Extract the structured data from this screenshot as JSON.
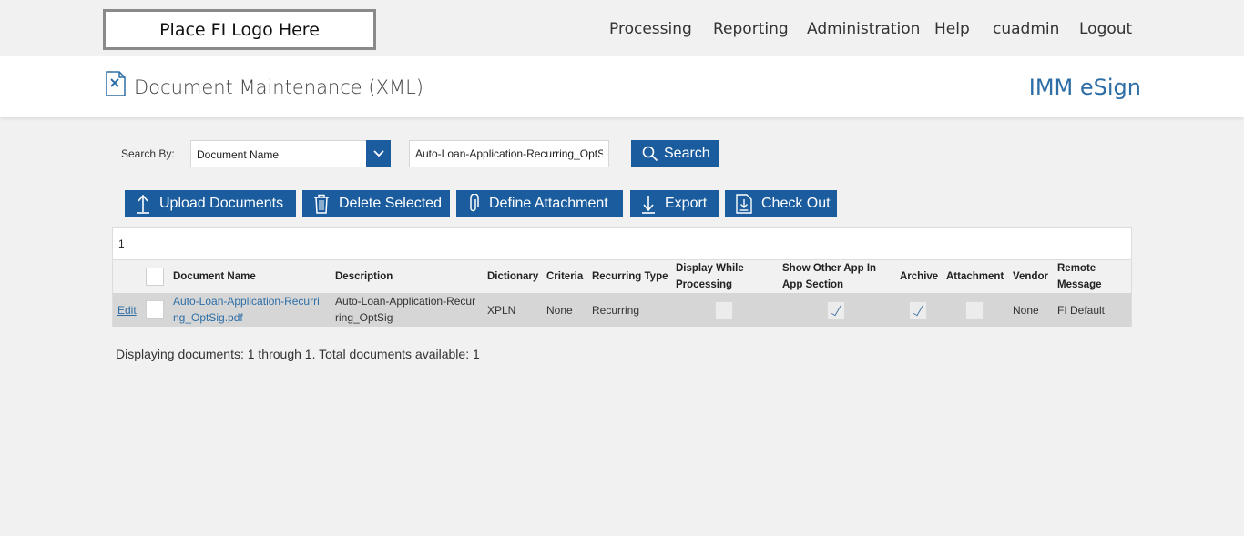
{
  "header": {
    "logo_text": "Place FI Logo Here",
    "nav": [
      "Processing",
      "Reporting",
      "Administration",
      "Help",
      "cuadmin",
      "Logout"
    ]
  },
  "titlebar": {
    "title": "Document Maintenance (XML)",
    "brand": "IMM eSign",
    "icon": "document-edit-icon"
  },
  "search": {
    "label": "Search By:",
    "field_selected": "Document Name",
    "value": "Auto-Loan-Application-Recurring_OptSig.pdf",
    "button_label": "Search"
  },
  "actions": {
    "upload": "Upload Documents",
    "delete": "Delete Selected",
    "define_attachment": "Define Attachment",
    "export": "Export",
    "check_out": "Check Out"
  },
  "grid": {
    "page": "1",
    "columns": {
      "document_name": "Document Name",
      "description": "Description",
      "dictionary": "Dictionary",
      "criteria": "Criteria",
      "recurring_type": "Recurring Type",
      "display_while_processing_1": "Display While",
      "display_while_processing_2": "Processing",
      "show_other_app_1": "Show Other App In",
      "show_other_app_2": "App Section",
      "archive": "Archive",
      "attachment": "Attachment",
      "vendor": "Vendor",
      "remote_message_1": "Remote",
      "remote_message_2": "Message"
    },
    "rows": [
      {
        "edit": "Edit",
        "document_name_1": "Auto-Loan-Application-Recurri",
        "document_name_2": "ng_OptSig.pdf",
        "description_1": "Auto-Loan-Application-Recur",
        "description_2": "ring_OptSig",
        "dictionary": "XPLN",
        "criteria": "None",
        "recurring_type": "Recurring",
        "display_while_processing": false,
        "show_other_app": true,
        "archive": true,
        "attachment": false,
        "vendor": "None",
        "remote_message": "FI Default"
      }
    ]
  },
  "footer": {
    "status": "Displaying documents: 1 through 1. Total documents available: 1"
  },
  "colors": {
    "primary": "#1a5c9e",
    "brand_text": "#2d6ea6",
    "background": "#f1f1f1"
  }
}
